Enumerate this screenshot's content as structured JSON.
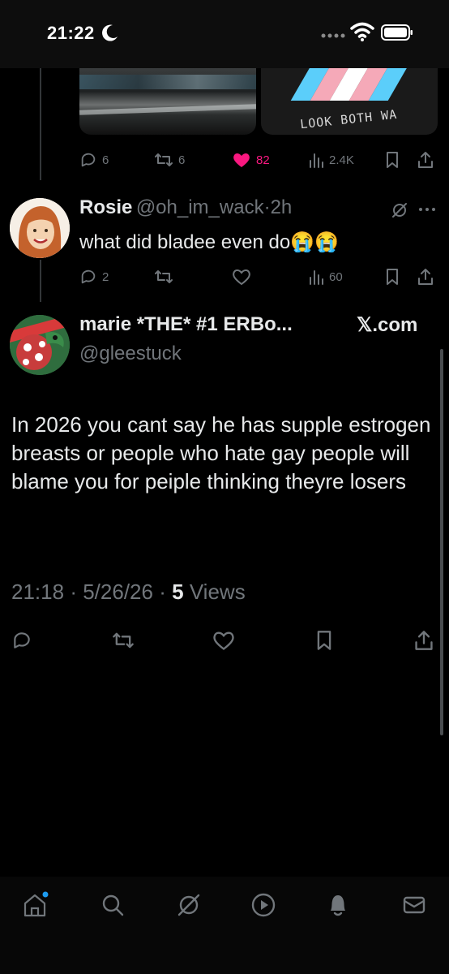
{
  "status_bar": {
    "time": "21:22"
  },
  "media": {
    "image2_text": "LOOK BOTH WA"
  },
  "quoted_tweet_actions": {
    "replies": "6",
    "retweets": "6",
    "likes": "82",
    "views": "2.4K"
  },
  "reply": {
    "name": "Rosie",
    "handle": "@oh_im_wack",
    "separator": "·",
    "time": "2h",
    "text": "what did bladee even do😭😭",
    "replies": "2",
    "views": "60"
  },
  "main_tweet": {
    "name": "marie *THE* #1 ERBo...",
    "source": "𝕏.com",
    "handle": "@gleestuck",
    "text": "In 2026 you cant say he has supple estrogen breasts or people who hate gay people will blame you for peiple thinking theyre losers",
    "time": "21:18",
    "sep1": "·",
    "date": "5/26/26",
    "sep2": "·",
    "views_count": "5",
    "views_label": "Views"
  },
  "colors": {
    "like": "#f91880",
    "accent": "#1d9bf0",
    "muted": "#71767b",
    "text": "#e7e9ea"
  },
  "bottom_nav": [
    "home-icon",
    "search-icon",
    "grok-icon",
    "video-icon",
    "notifications-icon",
    "messages-icon"
  ]
}
